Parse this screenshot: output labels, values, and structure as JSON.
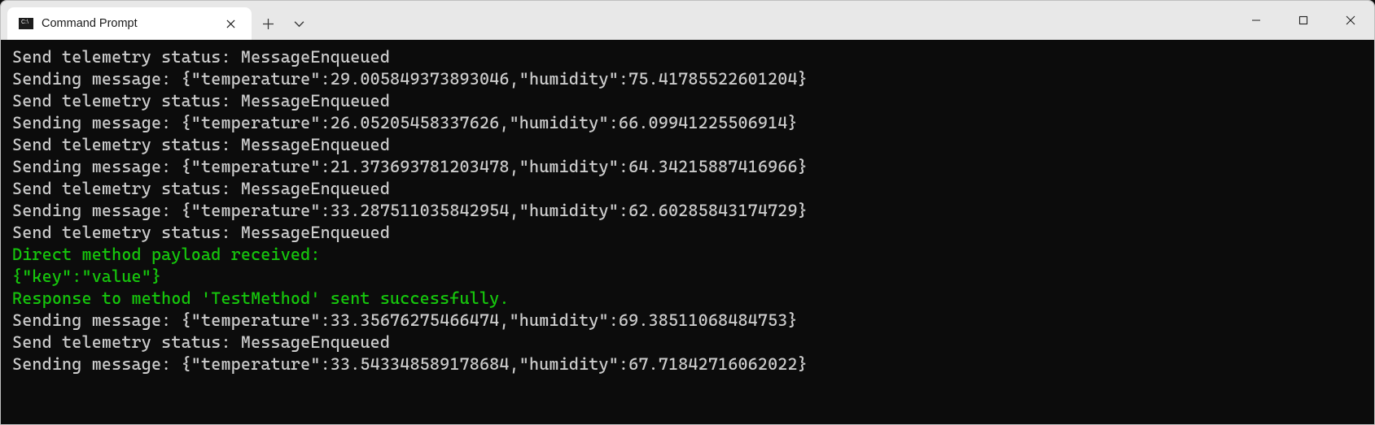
{
  "titlebar": {
    "tab_title": "Command Prompt"
  },
  "terminal": {
    "lines": [
      {
        "text": "Send telemetry status: MessageEnqueued",
        "color": "default"
      },
      {
        "text": "Sending message: {\"temperature\":29.005849373893046,\"humidity\":75.41785522601204}",
        "color": "default"
      },
      {
        "text": "Send telemetry status: MessageEnqueued",
        "color": "default"
      },
      {
        "text": "Sending message: {\"temperature\":26.05205458337626,\"humidity\":66.09941225506914}",
        "color": "default"
      },
      {
        "text": "Send telemetry status: MessageEnqueued",
        "color": "default"
      },
      {
        "text": "Sending message: {\"temperature\":21.373693781203478,\"humidity\":64.34215887416966}",
        "color": "default"
      },
      {
        "text": "Send telemetry status: MessageEnqueued",
        "color": "default"
      },
      {
        "text": "Sending message: {\"temperature\":33.287511035842954,\"humidity\":62.60285843174729}",
        "color": "default"
      },
      {
        "text": "Send telemetry status: MessageEnqueued",
        "color": "default"
      },
      {
        "text": "Direct method payload received:",
        "color": "green"
      },
      {
        "text": "{\"key\":\"value\"}",
        "color": "green"
      },
      {
        "text": "Response to method 'TestMethod' sent successfully.",
        "color": "green"
      },
      {
        "text": "Sending message: {\"temperature\":33.35676275466474,\"humidity\":69.38511068484753}",
        "color": "default"
      },
      {
        "text": "Send telemetry status: MessageEnqueued",
        "color": "default"
      },
      {
        "text": "Sending message: {\"temperature\":33.543348589178684,\"humidity\":67.71842716062022}",
        "color": "default"
      }
    ]
  }
}
